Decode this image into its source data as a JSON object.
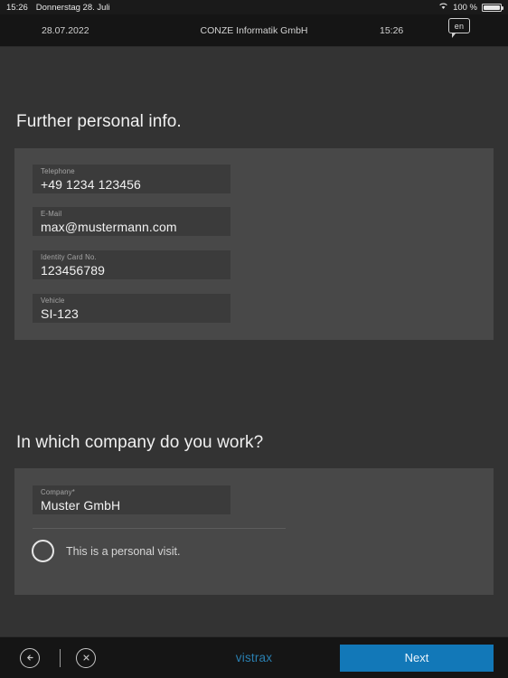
{
  "statusbar": {
    "time": "15:26",
    "date": "Donnerstag 28. Juli",
    "battery_percent": "100 %",
    "wifi_icon": "wifi-icon",
    "battery_icon": "battery-icon"
  },
  "header": {
    "date": "28.07.2022",
    "title": "CONZE Informatik GmbH",
    "time": "15:26",
    "language": "en",
    "language_icon": "speech-bubble-icon"
  },
  "personal_section": {
    "title": "Further personal info.",
    "fields": [
      {
        "label": "Telephone",
        "value": "+49 1234 123456"
      },
      {
        "label": "E-Mail",
        "value": "max@mustermann.com"
      },
      {
        "label": "Identity Card No.",
        "value": "123456789"
      },
      {
        "label": "Vehicle",
        "value": "SI-123"
      }
    ]
  },
  "company_section": {
    "title": "In which company do you work?",
    "field": {
      "label": "Company*",
      "value": "Muster GmbH"
    },
    "checkbox": {
      "label": "This is a personal visit.",
      "checked": false
    }
  },
  "bottombar": {
    "back_icon": "back-arrow-circle-icon",
    "close_icon": "close-circle-icon",
    "brand": "vistrax",
    "next_label": "Next"
  },
  "colors": {
    "page_background": "#333333",
    "card_background": "#484848",
    "field_background": "#3b3b3b",
    "bar_background": "#151515",
    "accent_blue": "#1278b8",
    "brand_blue": "#2a7fb0"
  }
}
